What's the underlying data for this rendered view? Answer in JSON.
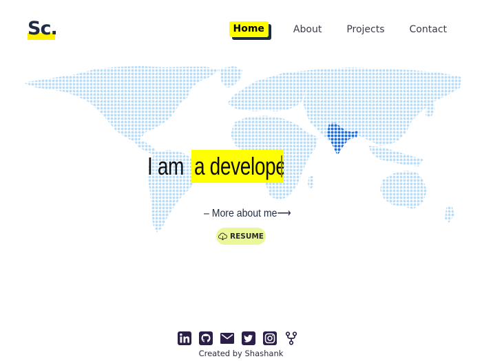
{
  "brand": {
    "logo_text": "Sc.",
    "accent": "#ffff00"
  },
  "nav": {
    "items": [
      {
        "label": "Home",
        "active": true
      },
      {
        "label": "About"
      },
      {
        "label": "Projects"
      },
      {
        "label": "Contact"
      }
    ]
  },
  "hero": {
    "prefix": "I am",
    "typed_word": "a develope",
    "more_link": "– More about me⟶",
    "resume_label": "RESUME",
    "resume_icon": "cloud-download-icon"
  },
  "colors": {
    "map_dots": "#b9dcf7",
    "highlight_country": "#1e6fd9",
    "nav_shadow": "#1a2b3a"
  },
  "footer": {
    "social_icons": [
      "linkedin-icon",
      "github-icon",
      "mail-icon",
      "twitter-icon",
      "instagram-icon",
      "fork-icon"
    ],
    "credit": "Created by Shashank"
  }
}
